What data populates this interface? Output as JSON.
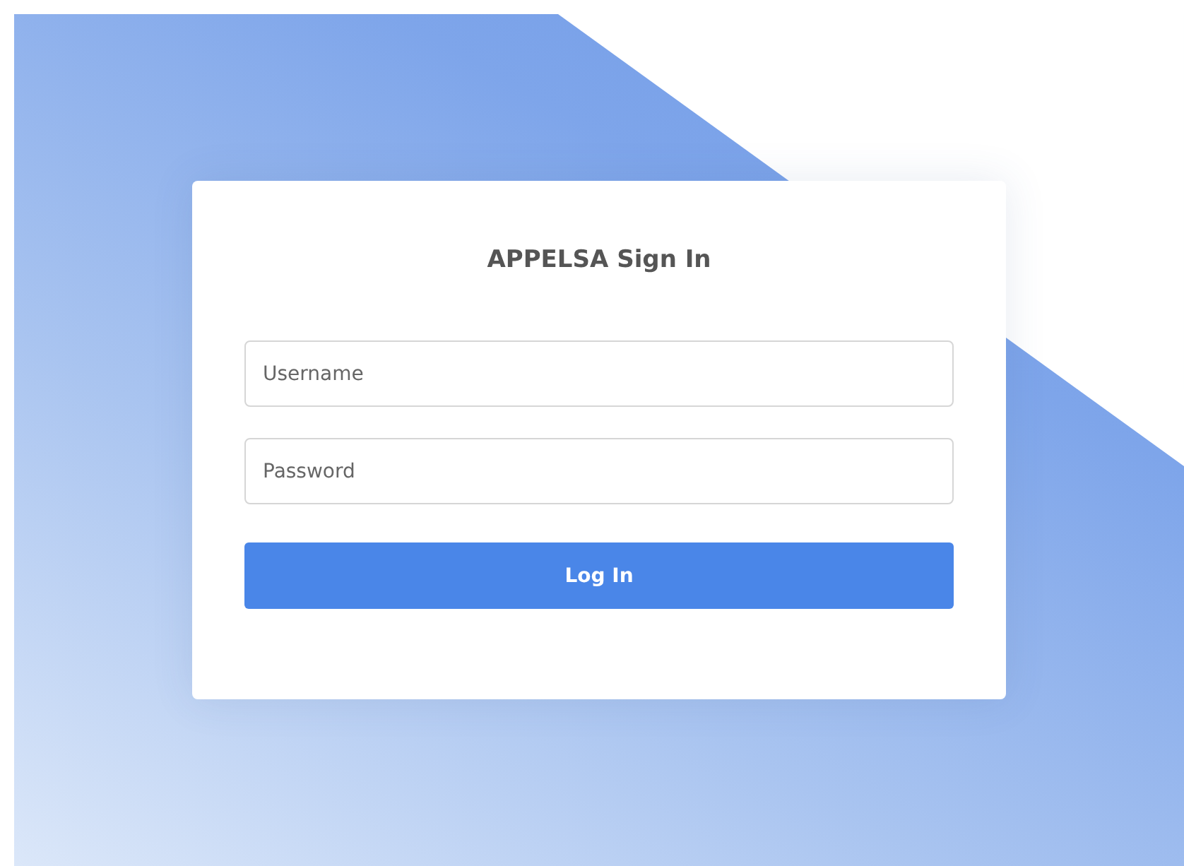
{
  "title": "APPELSA Sign In",
  "fields": [
    {
      "placeholder": "Username"
    },
    {
      "placeholder": "Password"
    }
  ],
  "button": "Log In"
}
